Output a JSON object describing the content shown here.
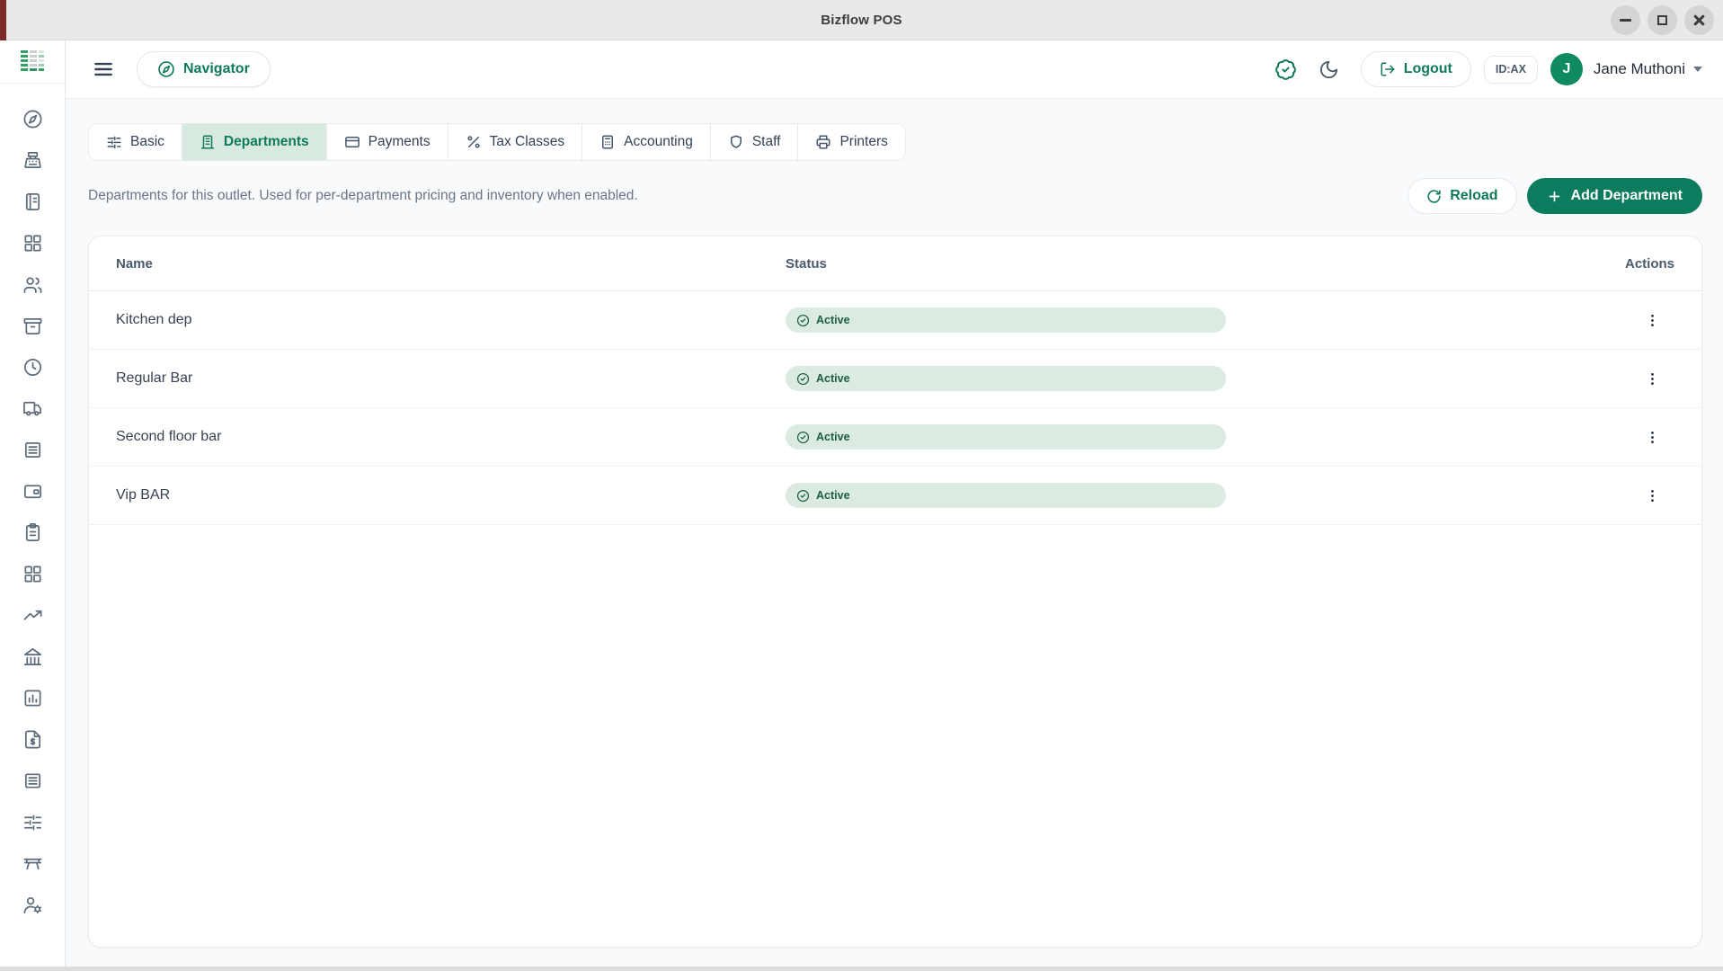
{
  "window": {
    "title": "Bizflow POS",
    "controls": {
      "minimize": "minimize-icon",
      "maximize": "maximize-icon",
      "close": "close-icon"
    }
  },
  "sidebar": {
    "logo": "bizflow-logo",
    "items": [
      "navigator",
      "cash-register",
      "sales-journal",
      "menu-grid",
      "customers",
      "stock-archive",
      "shifts",
      "deliveries",
      "order-logs",
      "wallet",
      "purchase-list",
      "apps-grid",
      "trends",
      "banking",
      "reports",
      "invoices",
      "ledger",
      "preferences",
      "tables",
      "user-management"
    ]
  },
  "header": {
    "menu_icon": "hamburger-menu-icon",
    "navigator_label": "Navigator",
    "status_icon": "badge-check-icon",
    "theme_icon": "moon-icon",
    "logout_label": "Logout",
    "terminal_id": "ID:AX",
    "user": {
      "initial": "J",
      "name": "Jane Muthoni"
    }
  },
  "tabs": [
    {
      "label": "Basic",
      "icon": "sliders-icon",
      "active": false
    },
    {
      "label": "Departments",
      "icon": "building-icon",
      "active": true
    },
    {
      "label": "Payments",
      "icon": "credit-card-icon",
      "active": false
    },
    {
      "label": "Tax Classes",
      "icon": "percent-icon",
      "active": false
    },
    {
      "label": "Accounting",
      "icon": "calculator-icon",
      "active": false
    },
    {
      "label": "Staff",
      "icon": "shield-icon",
      "active": false
    },
    {
      "label": "Printers",
      "icon": "printer-icon",
      "active": false
    }
  ],
  "content": {
    "description": "Departments for this outlet. Used for per-department pricing and inventory when enabled.",
    "reload_label": "Reload",
    "add_department_label": "Add Department",
    "table": {
      "columns": {
        "name": "Name",
        "status": "Status",
        "actions": "Actions"
      },
      "rows": [
        {
          "name": "Kitchen dep",
          "status": "Active"
        },
        {
          "name": "Regular Bar",
          "status": "Active"
        },
        {
          "name": "Second floor bar",
          "status": "Active"
        },
        {
          "name": "Vip BAR",
          "status": "Active"
        }
      ]
    }
  },
  "colors": {
    "brand_green": "#0e7a5b",
    "button_green": "#0c7b5e",
    "active_tab_bg": "#d8e9e0",
    "badge_bg": "#dcebe2",
    "badge_text": "#1b5e43",
    "avatar_bg": "#0f8a63",
    "titlebar_bg": "#e9e9e9",
    "titlebar_accent": "#7d2b26"
  }
}
